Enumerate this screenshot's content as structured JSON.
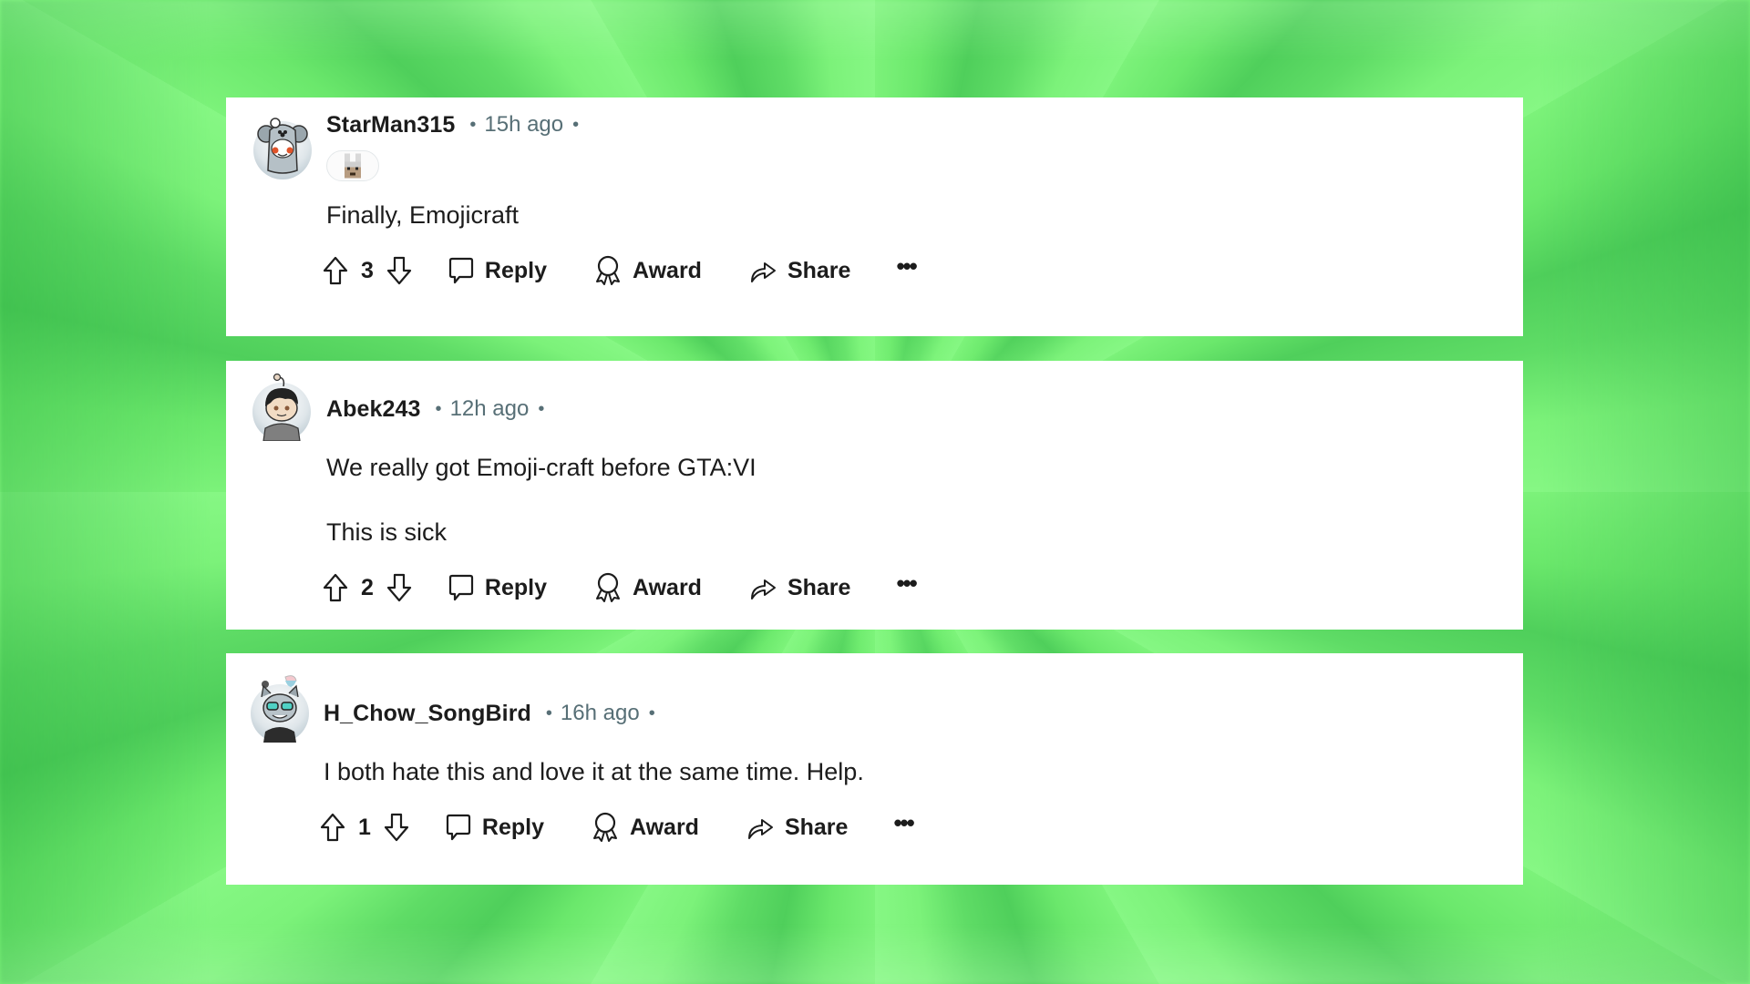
{
  "colors": {
    "background_light": "#7ef47a",
    "background_dark": "#4cc95a",
    "card": "#ffffff",
    "text_primary": "#1c1c1c",
    "text_meta": "#576f76"
  },
  "comments": [
    {
      "username": "StarMan315",
      "separator": "•",
      "time": "15h ago",
      "avatar_icon": "koala-snoo-avatar",
      "flair_icon": "pixel-llama-flair",
      "body": [
        "Finally, Emojicraft"
      ],
      "score": "3",
      "actions": {
        "reply": "Reply",
        "award": "Award",
        "share": "Share",
        "more": "•••"
      }
    },
    {
      "username": "Abek243",
      "separator": "•",
      "time": "12h ago",
      "avatar_icon": "dark-hair-snoo-avatar",
      "body": [
        "We really got Emoji-craft before GTA:VI",
        "This is sick"
      ],
      "score": "2",
      "actions": {
        "reply": "Reply",
        "award": "Award",
        "share": "Share",
        "more": "•••"
      }
    },
    {
      "username": "H_Chow_SongBird",
      "separator": "•",
      "time": "16h ago",
      "avatar_icon": "cat-sunglasses-snoo-avatar",
      "body": [
        "I both hate this and love it at the same time. Help."
      ],
      "score": "1",
      "actions": {
        "reply": "Reply",
        "award": "Award",
        "share": "Share",
        "more": "•••"
      }
    }
  ]
}
